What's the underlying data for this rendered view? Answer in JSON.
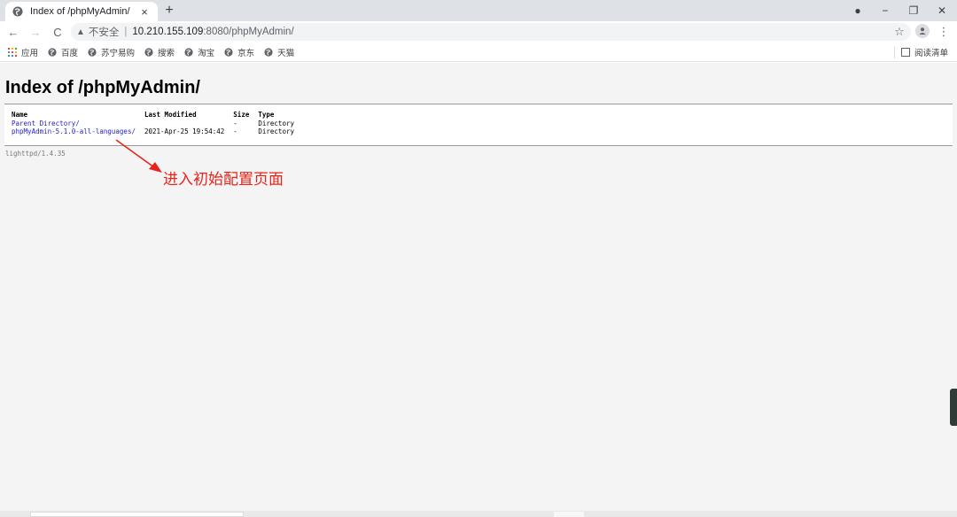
{
  "browser": {
    "tab": {
      "title": "Index of /phpMyAdmin/",
      "close_glyph": "×",
      "favicon": "globe-icon"
    },
    "new_tab_glyph": "+",
    "window_controls": {
      "extension_glyph": "●",
      "minimize_glyph": "−",
      "restore_glyph": "❐",
      "close_glyph": "✕"
    },
    "nav": {
      "back_glyph": "←",
      "forward_glyph": "→",
      "reload_glyph": "C"
    },
    "address": {
      "warning_glyph": "▲",
      "insecure_label": "不安全",
      "separator": "|",
      "host": "10.210.155.109",
      "path": ":8080/phpMyAdmin/"
    },
    "star_glyph": "☆",
    "menu_glyph": "⋮",
    "bookmarks": [
      {
        "label": "应用",
        "icon": "apps-grid-icon"
      },
      {
        "label": "百度",
        "icon": "globe-icon"
      },
      {
        "label": "苏宁易购",
        "icon": "globe-icon"
      },
      {
        "label": "搜索",
        "icon": "globe-icon"
      },
      {
        "label": "淘宝",
        "icon": "globe-icon"
      },
      {
        "label": "京东",
        "icon": "globe-icon"
      },
      {
        "label": "天猫",
        "icon": "globe-icon"
      }
    ],
    "reading_list": "阅读清单"
  },
  "page": {
    "heading": "Index of /phpMyAdmin/",
    "columns": [
      "Name",
      "Last Modified",
      "Size",
      "Type"
    ],
    "rows": [
      {
        "name": "Parent Directory/",
        "modified": "",
        "size": "-",
        "type": "Directory"
      },
      {
        "name": "phpMyAdmin-5.1.0-all-languages/",
        "modified": "2021-Apr-25 19:54:42",
        "size": "-",
        "type": "Directory"
      }
    ],
    "footer": "lighttpd/1.4.35"
  },
  "annotation": {
    "text": "进入初始配置页面",
    "color": "#e8231a"
  },
  "colors": {
    "link": "#2222cc",
    "accent_red": "#e8231a",
    "tab_strip": "#dee1e6",
    "omnibox": "#f1f3f4",
    "page_bg": "#f4f4f4"
  }
}
